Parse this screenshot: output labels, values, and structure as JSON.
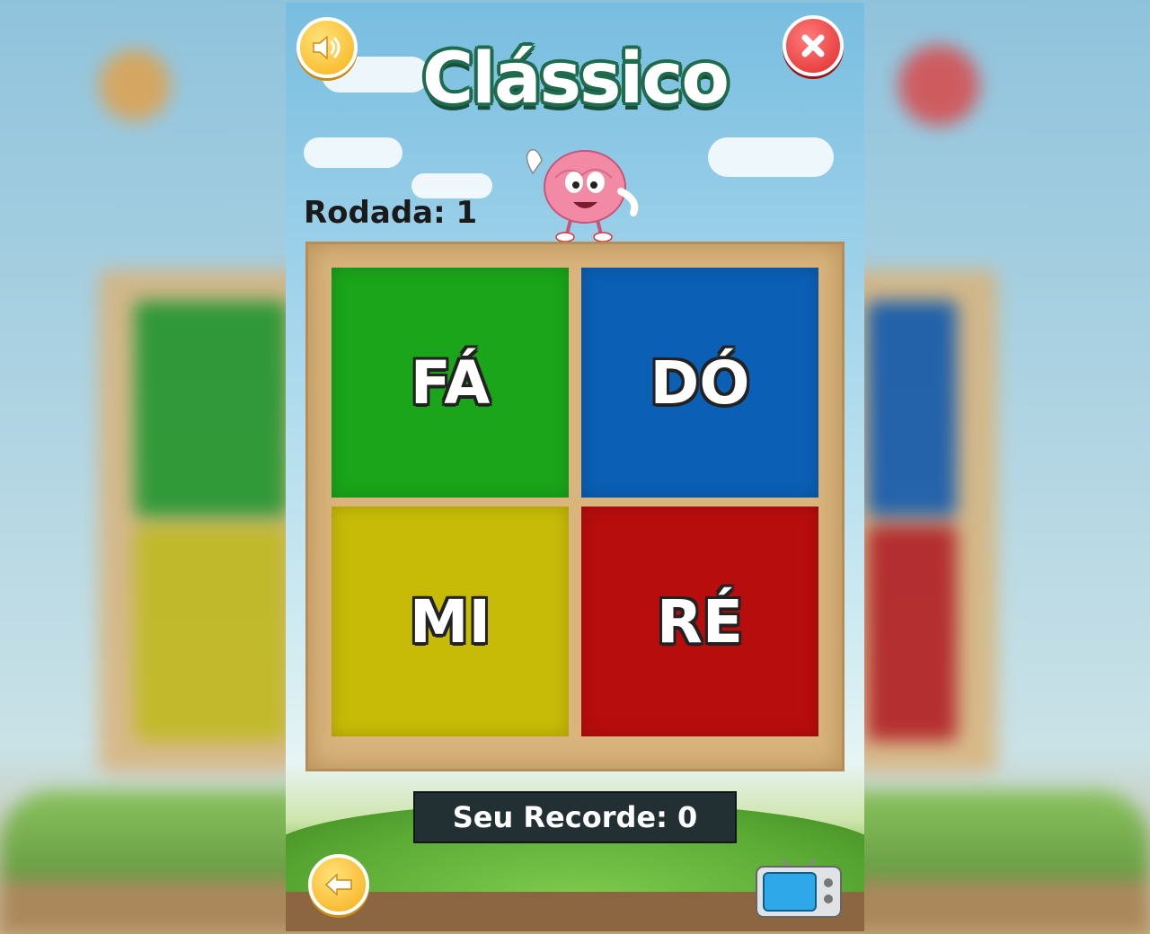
{
  "header": {
    "title": "Clássico"
  },
  "game": {
    "round_label": "Rodada: 1",
    "record_label": "Seu Recorde: 0",
    "tiles": [
      {
        "label": "FÁ",
        "color": "#1aa51a"
      },
      {
        "label": "DÓ",
        "color": "#0b5fb5"
      },
      {
        "label": "MI",
        "color": "#c7bb08"
      },
      {
        "label": "RÉ",
        "color": "#b80d0d"
      }
    ]
  },
  "icons": {
    "sound": "speaker-icon",
    "close": "close-icon",
    "back": "back-arrow-icon",
    "video": "tv-icon",
    "mascot": "brain-mascot"
  },
  "colors": {
    "title_outline": "#1f6b4e",
    "board": "#d9b47c",
    "record_bg": "#233033",
    "button_yellow": "#f7b21a",
    "button_red": "#e02a2a"
  }
}
